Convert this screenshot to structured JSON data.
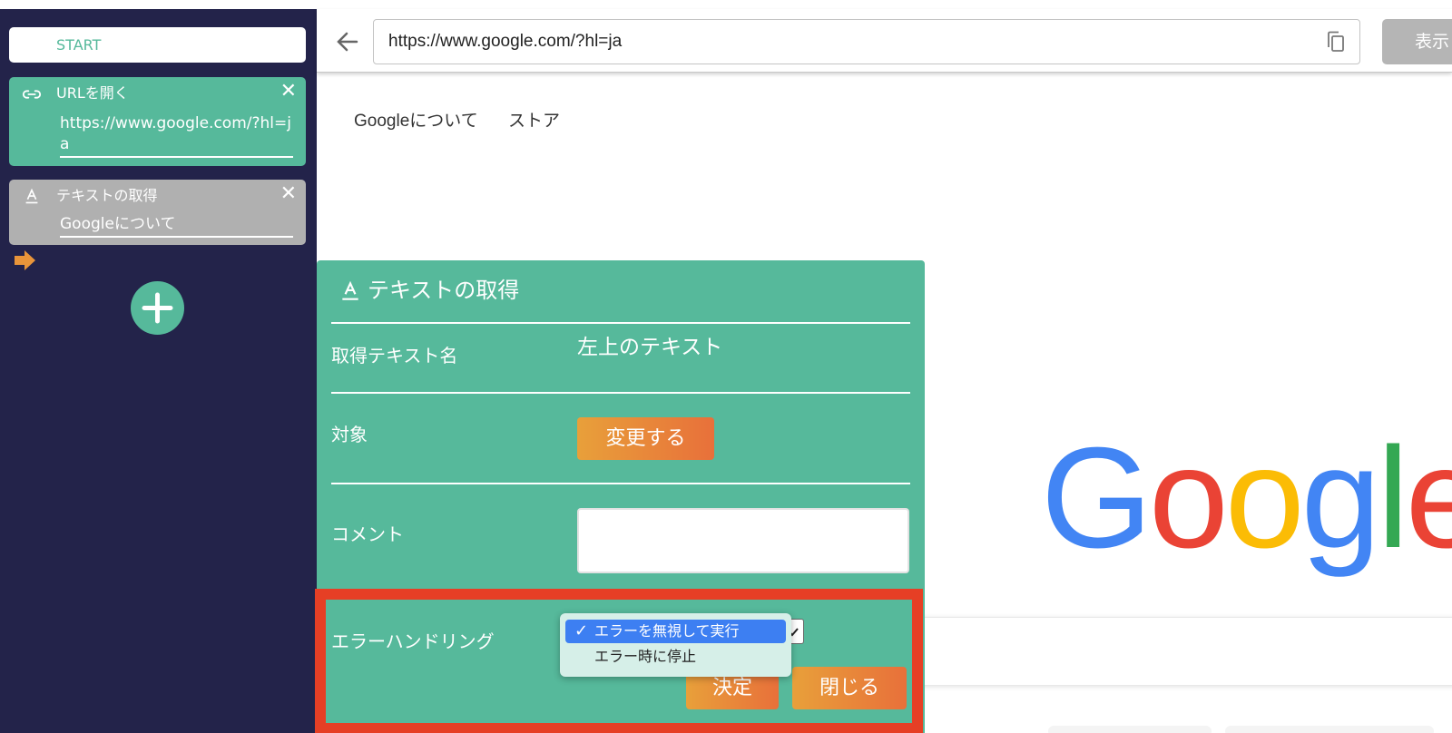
{
  "sidebar": {
    "start_label": "START",
    "steps": [
      {
        "title": "URLを開く",
        "value": "https://www.google.com/?hl=ja",
        "icon": "link-icon",
        "color": "#56b99b"
      },
      {
        "title": "テキストの取得",
        "value": "Googleについて",
        "icon": "text-format-icon",
        "color": "#b0b0b0"
      }
    ],
    "arrow_icon": "arrow-right-icon",
    "add_icon": "plus-icon"
  },
  "browser": {
    "url": "https://www.google.com/?hl=ja",
    "show_button_label": "表示"
  },
  "page": {
    "nav": [
      "Googleについて",
      "ストア"
    ],
    "logo_text": "Google",
    "logo_colors": [
      "#4285f4",
      "#ea4335",
      "#fbbc05",
      "#4285f4",
      "#34a853",
      "#ea4335"
    ]
  },
  "dialog": {
    "title": "テキストの取得",
    "fields": {
      "text_name_label": "取得テキスト名",
      "text_name_value": "左上のテキスト",
      "target_label": "対象",
      "change_button": "変更する",
      "comment_label": "コメント",
      "comment_value": "",
      "error_label": "エラーハンドリング"
    },
    "error_options": [
      {
        "label": "エラーを無視して実行",
        "selected": true
      },
      {
        "label": "エラー時に停止",
        "selected": false
      }
    ],
    "ok_button": "決定",
    "close_button": "閉じる"
  },
  "colors": {
    "accent": "#56b99b",
    "sidebar_bg": "#23234a",
    "button_orange": "#e8883a",
    "highlight": "#e63f25"
  }
}
